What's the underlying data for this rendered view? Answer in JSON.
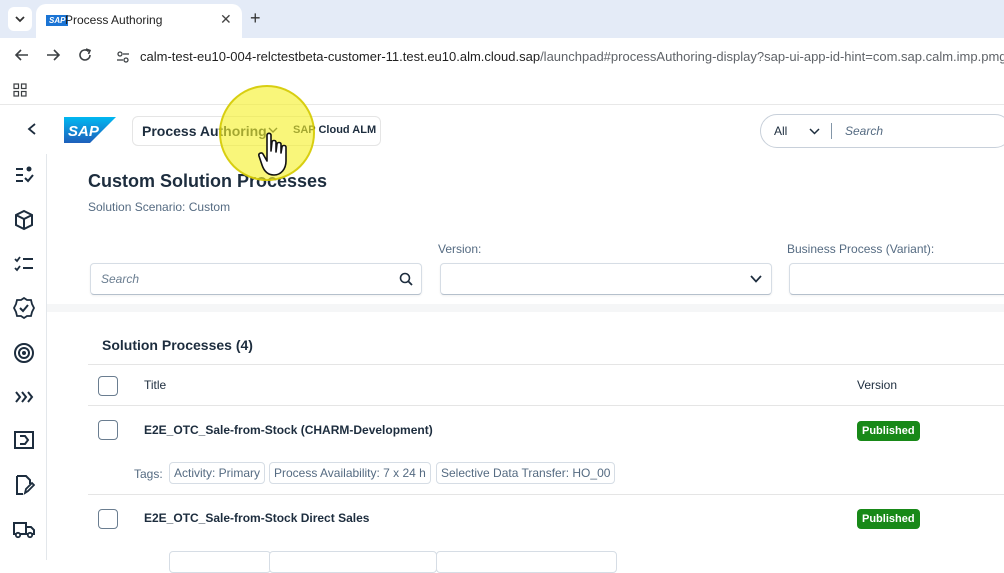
{
  "browser": {
    "tab_title": "Process Authoring",
    "tab_favicon_text": "SAP",
    "url_host": "calm-test-eu10-004-relctestbeta-customer-11.test.eu10.alm.cloud.sap",
    "url_path": "/launchpad#processAuthoring-display?sap-ui-app-id-hint=com.sap.calm.imp.pmge.author"
  },
  "shell": {
    "logo_text": "SAP",
    "app_title": "Process Authoring",
    "app_subtitle": "SAP Cloud ALM",
    "search_scope": "All",
    "search_placeholder": "Search"
  },
  "page": {
    "title": "Custom Solution Processes",
    "subtitle": "Solution Scenario: Custom",
    "filter_search_placeholder": "Search",
    "version_label": "Version:",
    "business_process_label": "Business Process (Variant):"
  },
  "list": {
    "title": "Solution Processes (4)",
    "col_title": "Title",
    "col_version": "Version",
    "rows": [
      {
        "title": "E2E_OTC_Sale-from-Stock (CHARM-Development)",
        "status": "Published",
        "tags_label": "Tags:",
        "tags": [
          "Activity: Primary",
          "Process Availability: 7 x 24 h",
          "Selective Data Transfer: HO_00"
        ]
      },
      {
        "title": "E2E_OTC_Sale-from-Stock Direct Sales",
        "status": "Published"
      }
    ]
  },
  "colors": {
    "accent": "#0070f2",
    "published": "#188918",
    "cursor_highlight": "#f5f028"
  },
  "sidebar_icons": [
    "tasks-icon",
    "package-icon",
    "checklist-icon",
    "approval-badge-icon",
    "target-icon",
    "chevrons-right-icon",
    "process-icon",
    "edit-document-icon",
    "truck-icon"
  ]
}
